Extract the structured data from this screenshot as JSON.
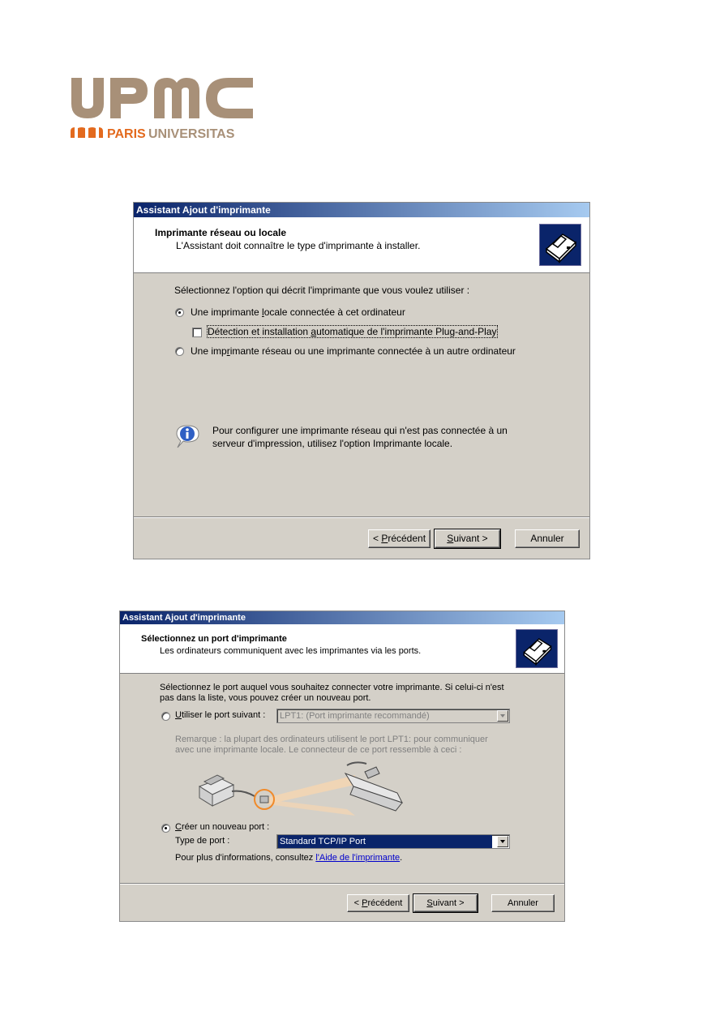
{
  "logo": {
    "letters": "UPMC",
    "line1": "PARIS",
    "line2": "UNIVERSITAS",
    "colors": {
      "brand_tan": "#a89078",
      "brand_orange": "#e36a1e"
    }
  },
  "dialog1": {
    "title": "Assistant Ajout d'imprimante",
    "header_title": "Imprimante réseau ou locale",
    "header_subtitle": "L'Assistant doit connaître le type d'imprimante à installer.",
    "prompt": "Sélectionnez l'option qui décrit l'imprimante que vous voulez utiliser :",
    "option_local": {
      "pre": "Une imprimante ",
      "key": "l",
      "post": "ocale connectée à cet ordinateur",
      "selected": true
    },
    "checkbox_pnp": {
      "pre": "Détection et installation ",
      "key": "a",
      "post": "utomatique de l'imprimante Plug-and-Play",
      "checked": false
    },
    "option_network": {
      "pre": "Une imp",
      "key": "r",
      "post": "imante réseau ou une imprimante connectée à un autre ordinateur",
      "selected": false
    },
    "info_line1": "Pour configurer une imprimante réseau qui n'est pas connectée à un",
    "info_line2": "serveur d'impression, utilisez l'option Imprimante locale.",
    "buttons": {
      "back": {
        "pre": "< ",
        "key": "P",
        "post": "récédent"
      },
      "next": {
        "pre": "",
        "key": "S",
        "post": "uivant >"
      },
      "cancel": "Annuler"
    }
  },
  "dialog2": {
    "title": "Assistant Ajout d'imprimante",
    "header_title": "Sélectionnez un port d'imprimante",
    "header_subtitle": "Les ordinateurs communiquent avec les imprimantes via les ports.",
    "prompt_line1": "Sélectionnez le port auquel vous souhaitez connecter votre imprimante. Si celui-ci n'est",
    "prompt_line2": "pas dans la liste, vous pouvez créer un nouveau port.",
    "option_existing": {
      "pre": "",
      "key": "U",
      "post": "tiliser le port suivant :",
      "selected": false
    },
    "existing_port_value": "LPT1: (Port imprimante recommandé)",
    "note_line1": "Remarque : la plupart des ordinateurs utilisent le port LPT1: pour communiquer",
    "note_line2": "avec une imprimante locale. Le connecteur de ce port ressemble à ceci :",
    "option_new": {
      "pre": "",
      "key": "C",
      "post": "réer un nouveau port :",
      "selected": true
    },
    "port_type_label": "Type de port :",
    "port_type_value": "Standard TCP/IP Port",
    "more_info_pre": "Pour plus d'informations, consultez ",
    "more_info_link": "l'Aide de l'imprimante",
    "more_info_post": ".",
    "buttons": {
      "back": {
        "pre": "< ",
        "key": "P",
        "post": "récédent"
      },
      "next": {
        "pre": "",
        "key": "S",
        "post": "uivant >"
      },
      "cancel": "Annuler"
    }
  }
}
